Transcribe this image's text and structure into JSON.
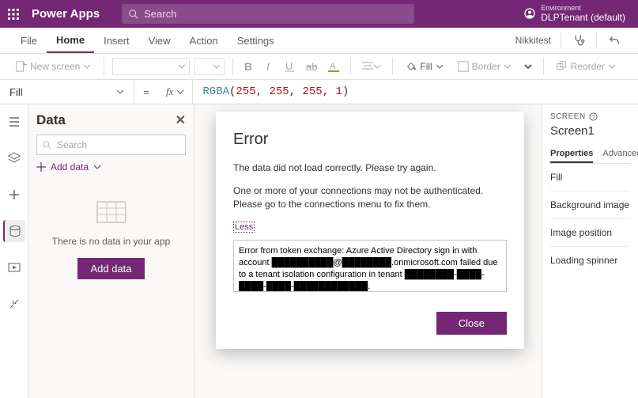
{
  "topbar": {
    "app_title": "Power Apps",
    "search_placeholder": "Search",
    "environment_label": "Environment",
    "environment_name": "DLPTenant (default)"
  },
  "menubar": {
    "items": [
      "File",
      "Home",
      "Insert",
      "View",
      "Action",
      "Settings"
    ],
    "active_index": 1,
    "username": "Nikkitest"
  },
  "ribbon": {
    "new_screen_label": "New screen",
    "fill_label": "Fill",
    "border_label": "Border",
    "reorder_label": "Reorder"
  },
  "formula_bar": {
    "property": "Fill",
    "equals": "=",
    "fx_label": "fx",
    "func": "RGBA",
    "args": [
      "255",
      "255",
      "255",
      "1"
    ]
  },
  "data_panel": {
    "title": "Data",
    "search_placeholder": "Search",
    "add_data_label": "Add data",
    "empty_text": "There is no data in your app",
    "add_button_label": "Add data"
  },
  "right_panel": {
    "screen_label": "SCREEN",
    "screen_name": "Screen1",
    "tabs": [
      "Properties",
      "Advanced"
    ],
    "active_tab": 0,
    "properties": [
      "Fill",
      "Background image",
      "Image position",
      "Loading spinner"
    ]
  },
  "modal": {
    "title": "Error",
    "p1": "The data did not load correctly. Please try again.",
    "p2": "One or more of your connections may not be authenticated. Please go to the connections menu to fix them.",
    "toggle_label": "Less",
    "details": "Error from token exchange: Azure Active Directory sign in with account ██████████@████████.onmicrosoft.com failed due to a tenant isolation configuration in tenant ████████-████-████-████-████████████.",
    "close_label": "Close"
  }
}
